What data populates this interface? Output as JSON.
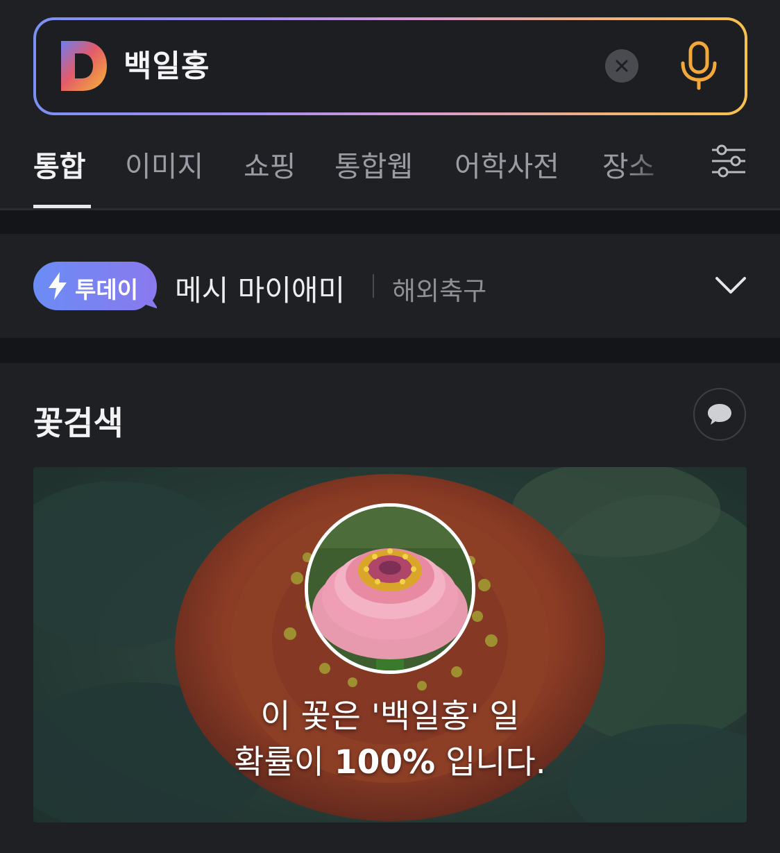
{
  "search": {
    "query": "백일홍",
    "logo_icon": "daum-d-logo",
    "clear_icon": "close-icon",
    "mic_icon": "microphone-icon"
  },
  "tabs": [
    {
      "label": "통합",
      "active": true
    },
    {
      "label": "이미지",
      "active": false
    },
    {
      "label": "쇼핑",
      "active": false
    },
    {
      "label": "통합웹",
      "active": false
    },
    {
      "label": "어학사전",
      "active": false
    },
    {
      "label": "장소",
      "active": false
    }
  ],
  "filter_icon": "settings-sliders-icon",
  "today": {
    "badge_label": "투데이",
    "badge_icon": "lightning-icon",
    "issue_title": "메시 마이애미",
    "issue_category": "해외축구",
    "expand_icon": "chevron-down-icon"
  },
  "flower_search": {
    "title": "꽃검색",
    "feedback_icon": "speech-bubble-icon",
    "result_prefix": "이 꽃은 '백일홍' 일",
    "result_line2_start": "확률이 ",
    "result_percent": "100%",
    "result_line2_end": " 입니다."
  },
  "colors": {
    "background": "#1c1d21",
    "accent_gradient_start": "#7c8ff5",
    "accent_gradient_end": "#f6c24e",
    "mic": "#f3a93a"
  }
}
